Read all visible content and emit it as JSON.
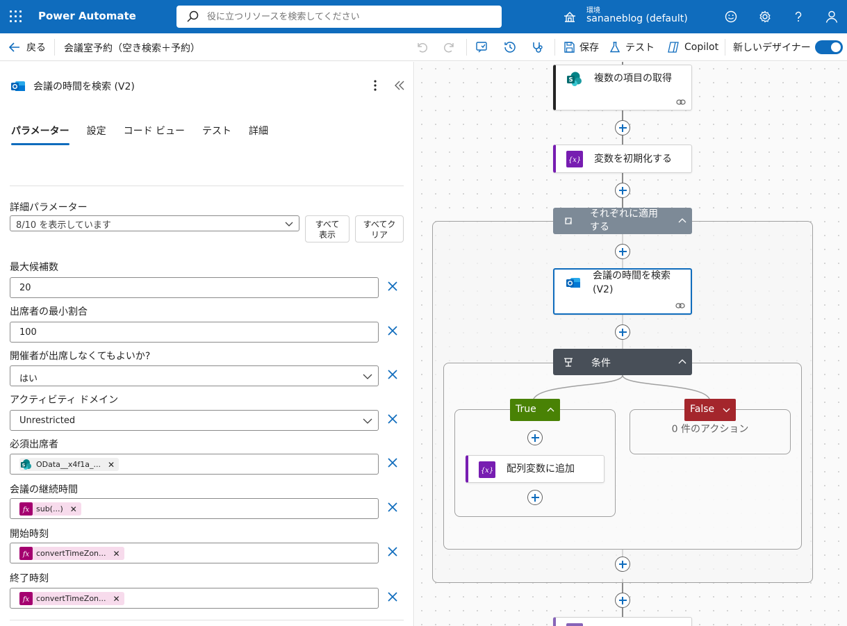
{
  "topbar": {
    "app_title": "Power Automate",
    "search_placeholder": "役に立つリソースを検索してください",
    "env_label": "環境",
    "env_name": "sananeblog (default)",
    "icons": [
      "waffle-icon",
      "search-icon",
      "environment-icon",
      "smiley-icon",
      "gear-icon",
      "help-icon",
      "person-icon"
    ]
  },
  "cmdbar": {
    "back_label": "戻る",
    "flow_name": "会議室予約（空き検索＋予約）",
    "save_label": "保存",
    "test_label": "テスト",
    "copilot_label": "Copilot",
    "new_designer_label": "新しいデザイナー",
    "new_designer_on": true
  },
  "panel": {
    "title": "会議の時間を検索 (V2)",
    "tabs": [
      {
        "label": "パラメーター",
        "active": true
      },
      {
        "label": "設定",
        "active": false
      },
      {
        "label": "コード ビュー",
        "active": false
      },
      {
        "label": "テスト",
        "active": false
      },
      {
        "label": "詳細",
        "active": false
      }
    ],
    "advanced": {
      "label": "詳細パラメーター",
      "select_value": "8/10 を表示しています",
      "show_all_line1": "すべて",
      "show_all_line2": "表示",
      "clear_all_line1": "すべてク",
      "clear_all_line2": "リア"
    },
    "fields": [
      {
        "label": "最大候補数",
        "value": "20",
        "type": "text"
      },
      {
        "label": "出席者の最小割合",
        "value": "100",
        "type": "text"
      },
      {
        "label": "開催者が出席しなくてもよいか?",
        "value": "はい",
        "type": "select"
      },
      {
        "label": "アクティビティ ドメイン",
        "value": "Unrestricted",
        "type": "select"
      },
      {
        "label": "必須出席者",
        "token": "OData__x4f1a_...",
        "type": "token-sp"
      },
      {
        "label": "会議の継続時間",
        "token": "sub(...)",
        "type": "token-fx"
      },
      {
        "label": "開始時刻",
        "token": "convertTimeZon...",
        "type": "token-fx"
      },
      {
        "label": "終了時刻",
        "token": "convertTimeZon...",
        "type": "token-fx"
      }
    ]
  },
  "canvas": {
    "get_items": "複数の項目の取得",
    "init_var": "変数を初期化する",
    "apply_each_line1": "それぞれに適用",
    "apply_each_line2": "する",
    "find_times_line1": "会議の時間を検索",
    "find_times_line2": "(V2)",
    "condition": "条件",
    "true_label": "True",
    "false_label": "False",
    "false_empty": "0 件のアクション",
    "append_array": "配列変数に追加"
  },
  "colors": {
    "brand": "#0f6cbd",
    "sharepoint": "#038387",
    "variable": "#771db1",
    "expression": "#a4006f",
    "true_green": "#498205",
    "false_red": "#a4262c",
    "loop_gray": "#7d8a97",
    "condition_dark": "#484f58"
  }
}
